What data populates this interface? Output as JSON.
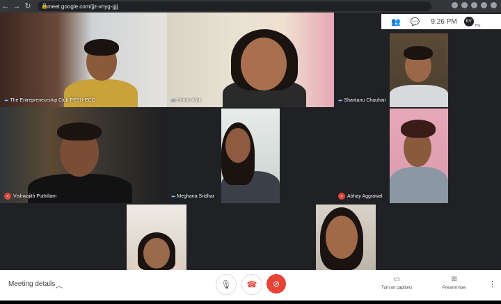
{
  "browser": {
    "url": "meet.google.com/jjz-vnyg-gjj",
    "back_icon": "←",
    "forward_icon": "→",
    "reload_icon": "↻"
  },
  "top_info": {
    "time": "9:26 PM",
    "you_label": "You",
    "you_initials": "KV"
  },
  "participants": [
    {
      "name": "The Entrepreneurship Club PESU-ECC",
      "muted": false
    },
    {
      "name": "Simmi Alok",
      "muted": false
    },
    {
      "name": "Shantanu Chauhan",
      "muted": false
    },
    {
      "name": "Vishwajith Puthillam",
      "muted": true
    },
    {
      "name": "Meghana Sridhar",
      "muted": false
    },
    {
      "name": "Abhay Aggrawal",
      "muted": true
    },
    {
      "name": "",
      "muted": false
    },
    {
      "name": "",
      "muted": false
    }
  ],
  "bottom": {
    "meeting_details": "Meeting details",
    "captions_label": "Turn on captions",
    "present_label": "Present now"
  },
  "colors": {
    "accent": "#ea4335",
    "bar": "#ffffff",
    "stage": "#202124"
  }
}
